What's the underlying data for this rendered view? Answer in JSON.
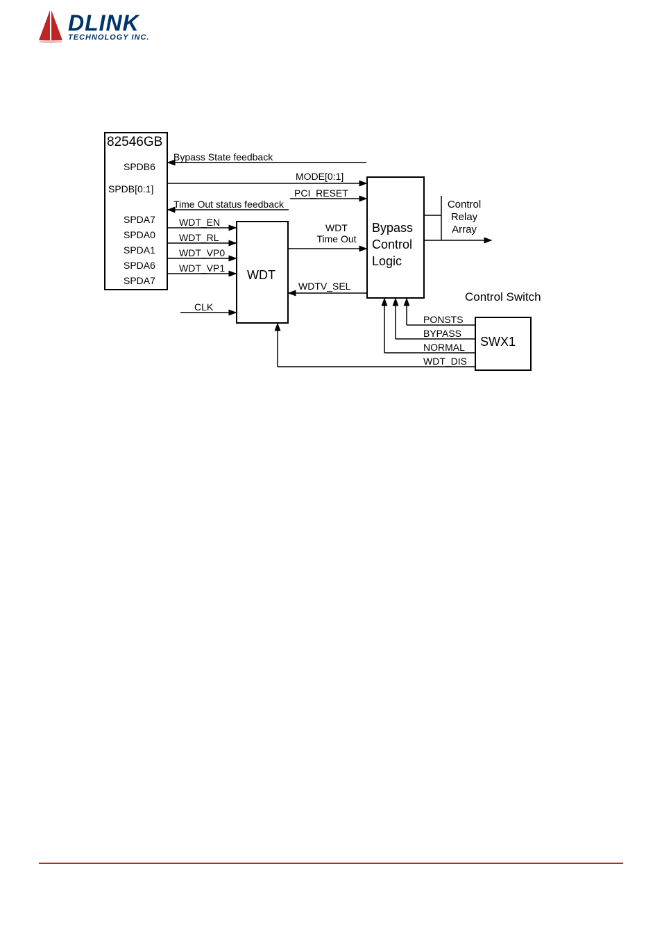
{
  "logo": {
    "main": "DLINK",
    "sub": "TECHNOLOGY INC."
  },
  "blocks": {
    "chip": "82546GB",
    "wdt": "WDT",
    "bypass": "Bypass Control Logic",
    "swx1": "SWX1"
  },
  "chip_pins": {
    "p1": "SPDB6",
    "p2": "SPDB[0:1]",
    "p3": "SPDA7",
    "p4": "SPDA0",
    "p5": "SPDA1",
    "p6": "SPDA6",
    "p7": "SPDA7"
  },
  "signals": {
    "bypass_fb": "Bypass State feedback",
    "mode": "MODE[0:1]",
    "pci_reset": "PCI_RESET",
    "timeout_fb": "Time Out status feedback",
    "wdt_en": "WDT_EN",
    "wdt_rl": "WDT_RL",
    "wdt_vp0": "WDT_VP0",
    "wdt_vp1": "WDT_VP1",
    "clk": "CLK",
    "wdt_timeout": "WDT Time Out",
    "wdtv_sel": "WDTV_SEL",
    "rel_ctrl": "Control Relay Array",
    "ctrl_switch": "Control Switch",
    "ponsts": "PONSTS",
    "bypass": "BYPASS",
    "normal": "NORMAL",
    "wdt_dis": "WDT_DIS"
  }
}
